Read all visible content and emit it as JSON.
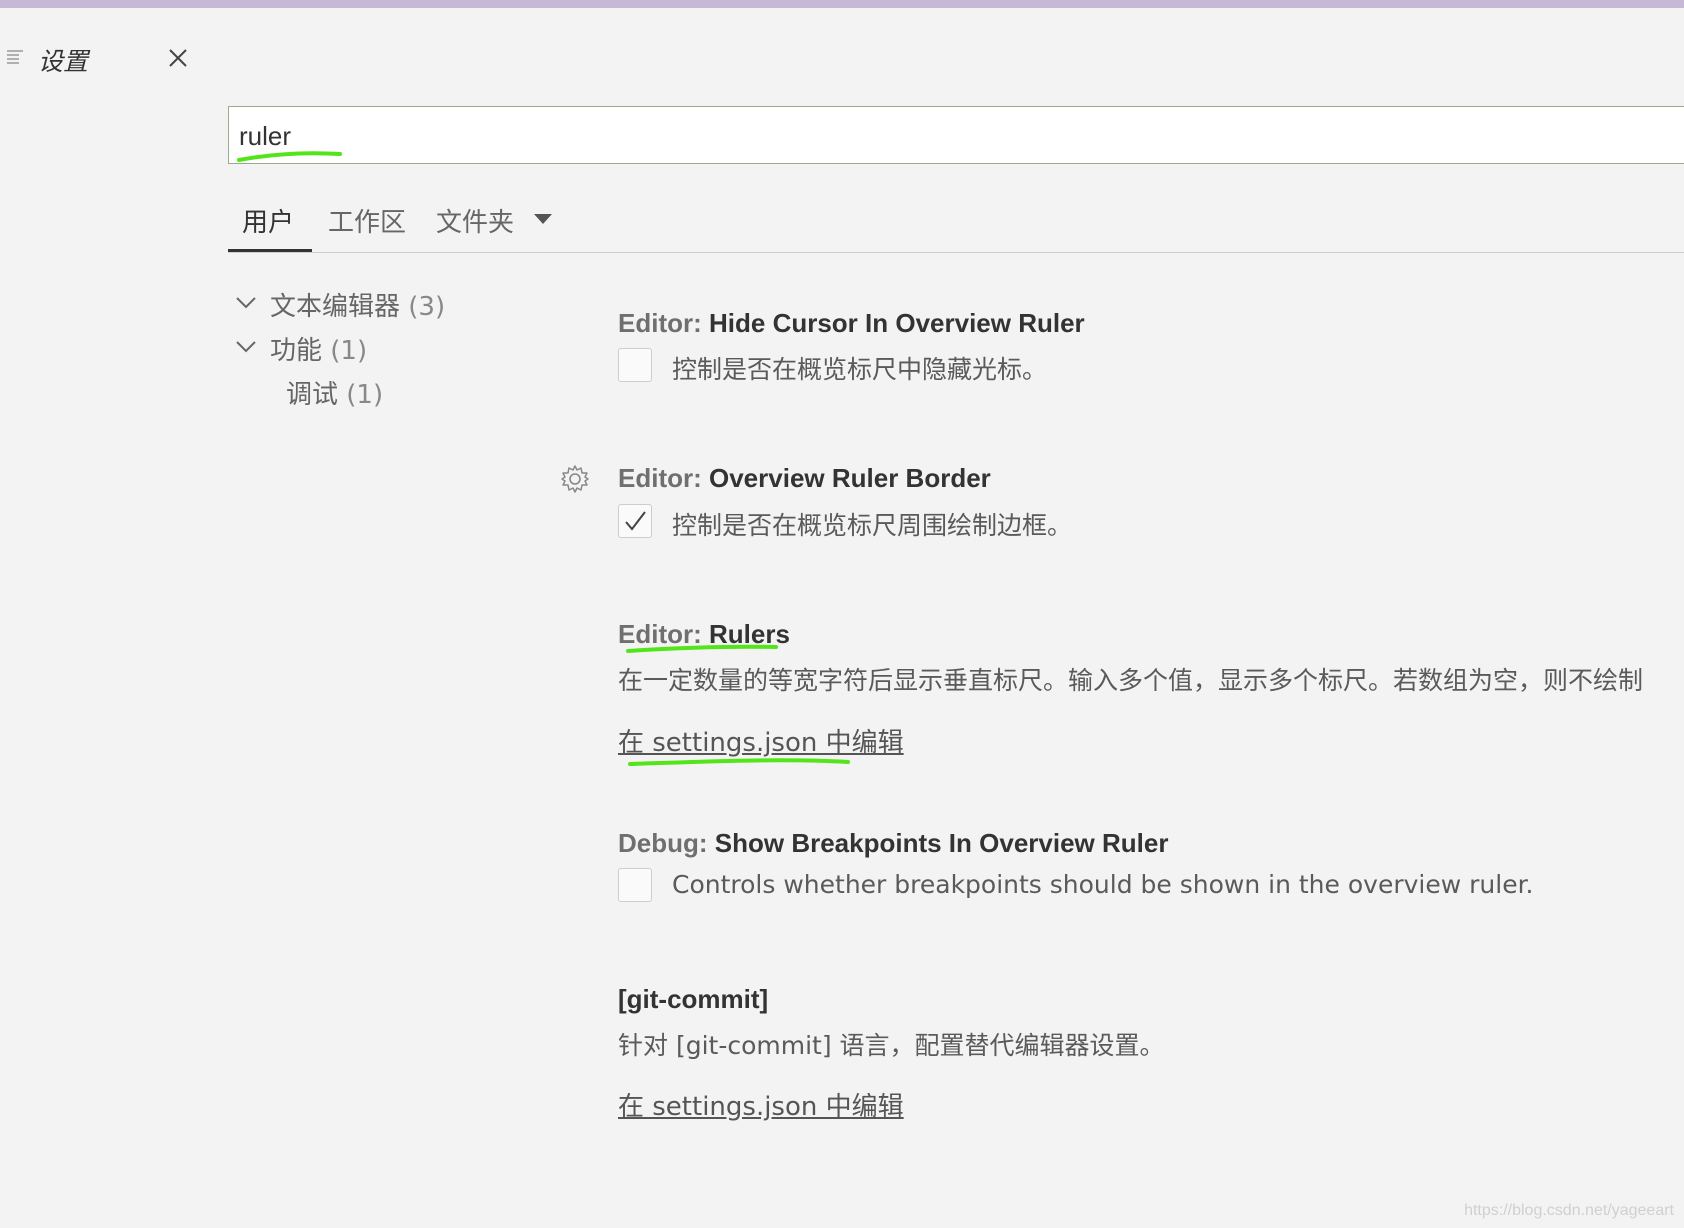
{
  "window": {
    "tab_title": "设置",
    "tab_icon": "settings-list-icon",
    "close_icon": "close-icon"
  },
  "search": {
    "value": "ruler",
    "placeholder": ""
  },
  "scope_tabs": {
    "user": "用户",
    "workspace": "工作区",
    "folder": "文件夹"
  },
  "toc": {
    "items": [
      {
        "label": "文本编辑器",
        "count": "(3)"
      },
      {
        "label": "功能",
        "count": "(1)"
      },
      {
        "label": "调试",
        "count": "(1)"
      }
    ]
  },
  "settings": [
    {
      "category": "Editor: ",
      "name": "Hide Cursor In Overview Ruler",
      "description": "控制是否在概览标尺中隐藏光标。",
      "checked": false
    },
    {
      "category": "Editor: ",
      "name": "Overview Ruler Border",
      "description": "控制是否在概览标尺周围绘制边框。",
      "checked": true
    },
    {
      "category": "Editor: ",
      "name": "Rulers",
      "description": "在一定数量的等宽字符后显示垂直标尺。输入多个值，显示多个标尺。若数组为空，则不绘制",
      "link": "在 settings.json 中编辑"
    },
    {
      "category": "Debug: ",
      "name": "Show Breakpoints In Overview Ruler",
      "description": "Controls whether breakpoints should be shown in the overview ruler.",
      "checked": false
    },
    {
      "category": "",
      "name": "[git-commit]",
      "description": "针对 [git-commit] 语言，配置替代编辑器设置。",
      "link": "在 settings.json 中编辑"
    }
  ],
  "watermark": "https://blog.csdn.net/yageeart",
  "colors": {
    "highlight": "#52e51a",
    "background": "#f3f3f3",
    "top_accent": "#c8b8d8"
  }
}
